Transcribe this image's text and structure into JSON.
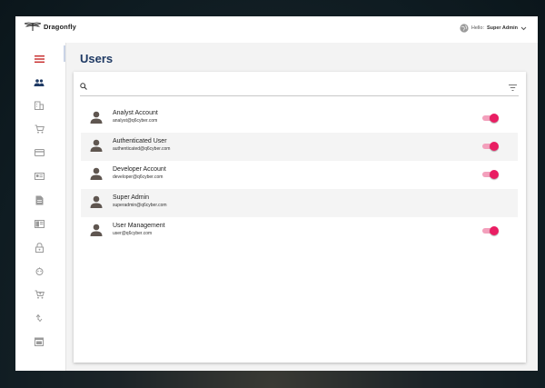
{
  "app": {
    "name": "Dragonfly",
    "logo_icon": "dragonfly-icon"
  },
  "header": {
    "greeting": "Hello:",
    "user_name": "Super Admin",
    "user_icon": "globe-icon"
  },
  "sidebar": {
    "items": [
      {
        "icon": "menu-icon",
        "active": false
      },
      {
        "icon": "people-icon",
        "active": true
      },
      {
        "icon": "building-icon",
        "active": false
      },
      {
        "icon": "cart-icon",
        "active": false
      },
      {
        "icon": "credit-card-icon",
        "active": false
      },
      {
        "icon": "id-card-icon",
        "active": false
      },
      {
        "icon": "document-icon",
        "active": false
      },
      {
        "icon": "layout-icon",
        "active": false
      },
      {
        "icon": "lock-icon",
        "active": false
      },
      {
        "icon": "cloud-icon",
        "active": false
      },
      {
        "icon": "cart-add-icon",
        "active": false
      },
      {
        "icon": "sync-icon",
        "active": false
      },
      {
        "icon": "calendar-icon",
        "active": false
      }
    ]
  },
  "page": {
    "title": "Users"
  },
  "search": {
    "placeholder": "",
    "value": ""
  },
  "users": [
    {
      "name": "Analyst Account",
      "email": "analyst@q6cyber.com",
      "enabled": true
    },
    {
      "name": "Authenticated User",
      "email": "authenticated@q6cyber.com",
      "enabled": true
    },
    {
      "name": "Developer Account",
      "email": "developer@q6cyber.com",
      "enabled": true
    },
    {
      "name": "Super Admin",
      "email": "superadmin@q6cyber.com",
      "enabled": null
    },
    {
      "name": "User Management",
      "email": "user@q6cyber.com",
      "enabled": true
    }
  ],
  "colors": {
    "accent": "#e91e63",
    "accent_track": "#f3a0bc",
    "title": "#1f3a64",
    "menu_icon": "#c62828"
  }
}
